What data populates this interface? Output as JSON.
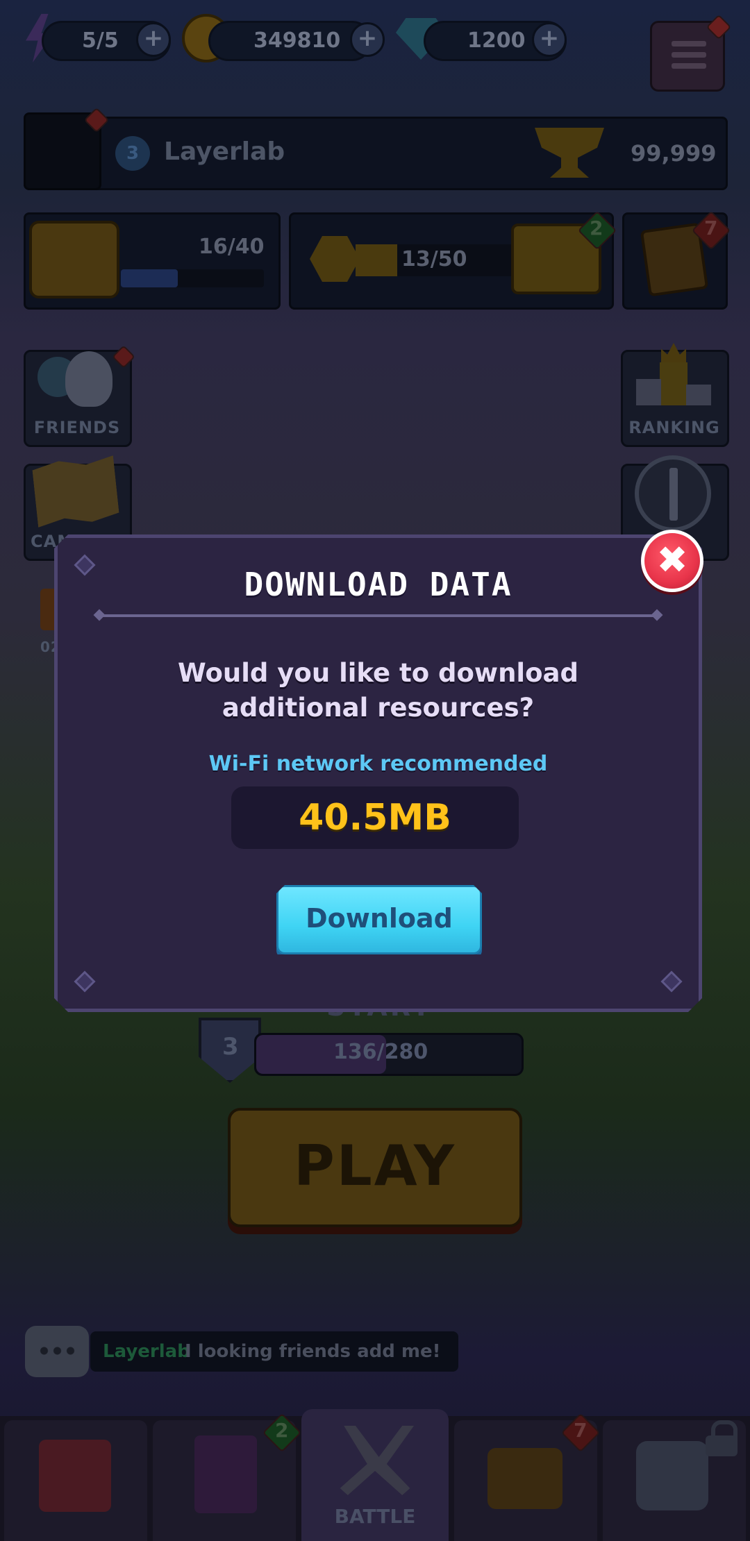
{
  "topbar": {
    "energy": "5/5",
    "coins": "349810",
    "gems": "1200",
    "plus_label": "+"
  },
  "profile": {
    "level": "3",
    "name": "Layerlab",
    "trophies": "99,999"
  },
  "progress_row": {
    "chest_progress": "16/40",
    "chest_progress_fraction": 0.4,
    "crown_progress": "13/50",
    "crown_progress_fraction": 0.26,
    "castle_badge": "2",
    "quest_badge": "7"
  },
  "side_tiles": {
    "friends": "FRIENDS",
    "ranking": "RANKING",
    "campaign_partial": "CAM",
    "left_counter_partial": "02"
  },
  "stage": {
    "level": "3",
    "xp": "136/280",
    "xp_fraction": 0.49,
    "partial_label": "START"
  },
  "play_button": "PLAY",
  "chat": {
    "user": "Layerlab",
    "message": "I looking friends add me!"
  },
  "bottom_nav": {
    "book_badge": "2",
    "battle_label": "BATTLE",
    "chest_badge": "7"
  },
  "popup": {
    "title": "DOWNLOAD DATA",
    "question": "Would you like to download additional resources?",
    "wifi_note": "Wi-Fi network recommended",
    "size": "40.5MB",
    "download_label": "Download",
    "close_symbol": "✖"
  },
  "colors": {
    "accent_cyan": "#3fd4f4",
    "size_yellow": "#ffc21a",
    "close_red": "#e8344a",
    "popup_bg": "#2c2442"
  }
}
